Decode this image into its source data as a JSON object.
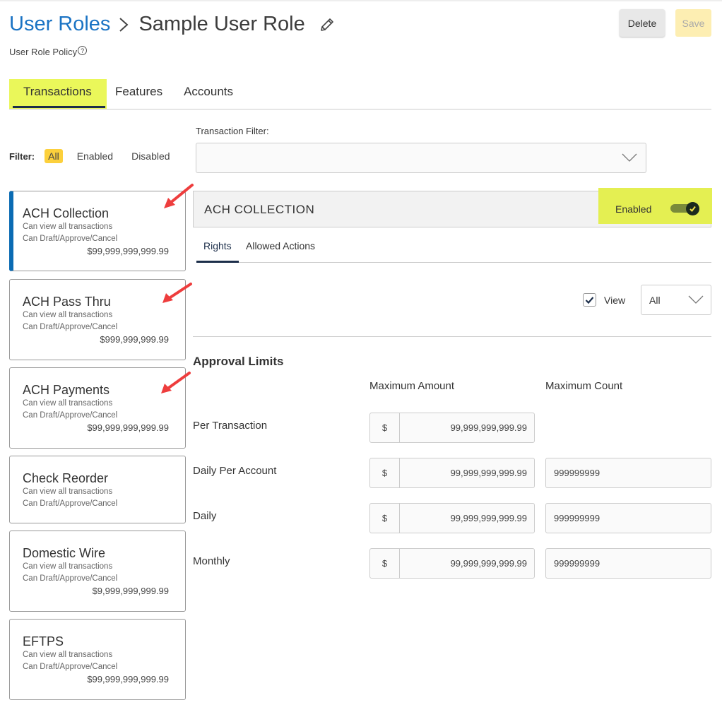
{
  "header": {
    "breadcrumb_link": "User Roles",
    "breadcrumb_separator": ">",
    "title": "Sample User Role",
    "subtitle": "User Role Policy",
    "help_icon": "?",
    "delete_label": "Delete",
    "save_label": "Save"
  },
  "tabs": [
    {
      "label": "Transactions",
      "active": true
    },
    {
      "label": "Features",
      "active": false
    },
    {
      "label": "Accounts",
      "active": false
    }
  ],
  "filter": {
    "label": "Filter:",
    "options": [
      "All",
      "Enabled",
      "Disabled"
    ],
    "selected": "All"
  },
  "transaction_filter": {
    "label": "Transaction Filter:",
    "value": ""
  },
  "transactions": [
    {
      "name": "ACH Collection",
      "line1": "Can view all transactions",
      "line2": "Can Draft/Approve/Cancel",
      "amount": "$99,999,999,999.99",
      "active": true
    },
    {
      "name": "ACH Pass Thru",
      "line1": "Can view all transactions",
      "line2": "Can Draft/Approve/Cancel",
      "amount": "$999,999,999.99",
      "active": false
    },
    {
      "name": "ACH Payments",
      "line1": "Can view all transactions",
      "line2": "Can Draft/Approve/Cancel",
      "amount": "$99,999,999,999.99",
      "active": false
    },
    {
      "name": "Check Reorder",
      "line1": "Can view all transactions",
      "line2": "Can Draft/Approve/Cancel",
      "amount": "",
      "active": false
    },
    {
      "name": "Domestic Wire",
      "line1": "Can view all transactions",
      "line2": "Can Draft/Approve/Cancel",
      "amount": "$9,999,999,999.99",
      "active": false
    },
    {
      "name": "EFTPS",
      "line1": "Can view all transactions",
      "line2": "Can Draft/Approve/Cancel",
      "amount": "$99,999,999,999.99",
      "active": false
    }
  ],
  "detail": {
    "title": "ACH COLLECTION",
    "enabled_label": "Enabled",
    "enabled": true,
    "subtabs": [
      "Rights",
      "Allowed Actions"
    ],
    "active_subtab": "Rights",
    "view_label": "View",
    "view_checked": true,
    "view_select": "All",
    "approval_title": "Approval Limits",
    "col_amount": "Maximum Amount",
    "col_count": "Maximum Count",
    "currency_symbol": "$",
    "limits": [
      {
        "label": "Per Transaction",
        "amount": "99,999,999,999.99",
        "count": null
      },
      {
        "label": "Daily Per Account",
        "amount": "99,999,999,999.99",
        "count": "999999999"
      },
      {
        "label": "Daily",
        "amount": "99,999,999,999.99",
        "count": "999999999"
      },
      {
        "label": "Monthly",
        "amount": "99,999,999,999.99",
        "count": "999999999"
      }
    ]
  },
  "colors": {
    "link_blue": "#1a73c4",
    "highlight_yellow": "#eaf75a",
    "active_filter": "#fcd03c",
    "active_card_bar": "#0a6bb3",
    "annotation_arrow": "#ee3d3d",
    "tab_underline": "#1c2e4a"
  }
}
